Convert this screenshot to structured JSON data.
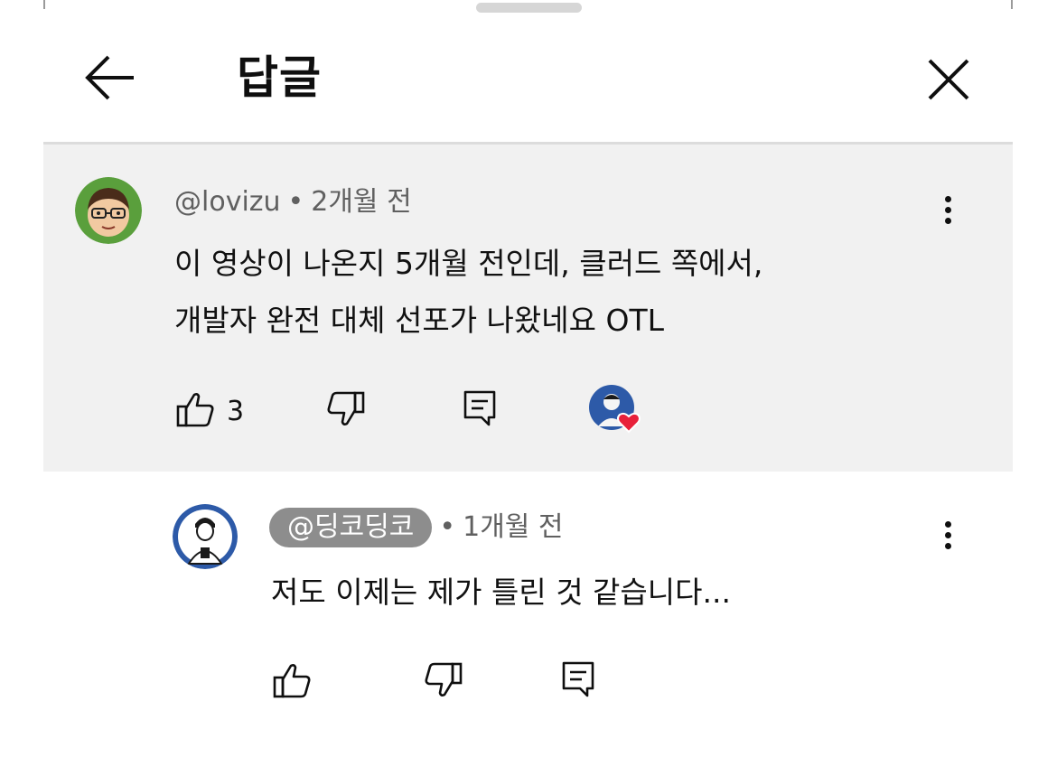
{
  "header": {
    "title": "답글",
    "back_icon": "arrow-left-icon",
    "close_icon": "close-icon"
  },
  "parent_comment": {
    "author": "@lovizu",
    "separator": "•",
    "time": "2개월 전",
    "lines": [
      "이 영상이 나온지 5개월 전인데, 클러드 쪽에서,",
      "개발자 완전 대체 선포가 나왔네요 OTL"
    ],
    "like_count": "3",
    "icons": {
      "like": "thumbs-up-icon",
      "dislike": "thumbs-down-icon",
      "reply": "reply-icon",
      "creator_heart": "creator-heart-icon",
      "menu": "kebab-menu-icon"
    },
    "avatar_color": "#5a9f3c"
  },
  "reply_comment": {
    "author": "@딩코딩코",
    "separator": "•",
    "time": "1개월 전",
    "lines": [
      "저도 이제는 제가 틀린 것 같습니다..."
    ],
    "icons": {
      "like": "thumbs-up-icon",
      "dislike": "thumbs-down-icon",
      "reply": "reply-icon",
      "menu": "kebab-menu-icon"
    },
    "avatar_color": "#2d5aa8"
  },
  "colors": {
    "parent_background": "#f1f1f1",
    "meta_text": "#606060",
    "author_chip": "#8d8d8d",
    "heart": "#e8203a"
  }
}
